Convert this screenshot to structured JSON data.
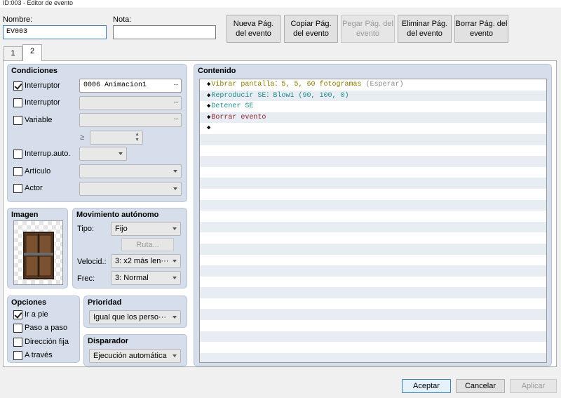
{
  "window": {
    "title": "ID:003 - Editor de evento"
  },
  "header": {
    "name_label": "Nombre:",
    "name_value": "EV003",
    "note_label": "Nota:",
    "note_value": ""
  },
  "toolbar": {
    "new_page": "Nueva Pág. del evento",
    "copy_page": "Copiar Pág. del evento",
    "paste_page": "Pegar Pág. del evento",
    "delete_page": "Eliminar Pág. del evento",
    "clear_page": "Borrar Pág. del evento"
  },
  "tabs": [
    {
      "label": "1"
    },
    {
      "label": "2"
    }
  ],
  "conditions": {
    "title": "Condiciones",
    "switch1": {
      "label": "Interruptor",
      "checked": true,
      "value": "0006 Animacion1"
    },
    "switch2": {
      "label": "Interruptor",
      "checked": false,
      "value": ""
    },
    "variable": {
      "label": "Variable",
      "checked": false,
      "value": "",
      "op": "≥",
      "amount": ""
    },
    "self_switch": {
      "label": "Interrup.auto.",
      "checked": false,
      "value": ""
    },
    "item": {
      "label": "Artículo",
      "checked": false,
      "value": ""
    },
    "actor": {
      "label": "Actor",
      "checked": false,
      "value": ""
    }
  },
  "image": {
    "title": "Imagen",
    "sprite": "door-sprite"
  },
  "movement": {
    "title": "Movimiento autónomo",
    "type_label": "Tipo:",
    "type_value": "Fijo",
    "route_button": "Ruta...",
    "speed_label": "Velocid.:",
    "speed_value": "3: x2 más len···",
    "freq_label": "Frec:",
    "freq_value": "3: Normal"
  },
  "options": {
    "title": "Opciones",
    "walk": {
      "label": "Ir a pie",
      "checked": true
    },
    "step": {
      "label": "Paso a paso",
      "checked": false
    },
    "dir_fix": {
      "label": "Dirección fija",
      "checked": false
    },
    "through": {
      "label": "A través",
      "checked": false
    }
  },
  "priority": {
    "title": "Prioridad",
    "value": "Igual que los perso···"
  },
  "trigger": {
    "title": "Disparador",
    "value": "Ejecución automática"
  },
  "contents": {
    "title": "Contenido",
    "lines": [
      {
        "prefix": "◆",
        "text": "Vibrar pantalla：5, 5, 60 fotogramas",
        "suffix": " (Esperar)",
        "color": "#8a7a00"
      },
      {
        "prefix": "◆",
        "text": "Reproducir SE：Blow1 (90, 100, 0)",
        "suffix": "",
        "color": "#1f8a8a"
      },
      {
        "prefix": "◆",
        "text": "Detener SE",
        "suffix": "",
        "color": "#1f8a8a"
      },
      {
        "prefix": "◆",
        "text": "Borrar evento",
        "suffix": "",
        "color": "#8a1f2a"
      },
      {
        "prefix": "◆",
        "text": "",
        "suffix": "",
        "color": "#000000"
      }
    ],
    "suffix_color": "#8a8a8a"
  },
  "footer": {
    "ok": "Aceptar",
    "cancel": "Cancelar",
    "apply": "Aplicar"
  }
}
